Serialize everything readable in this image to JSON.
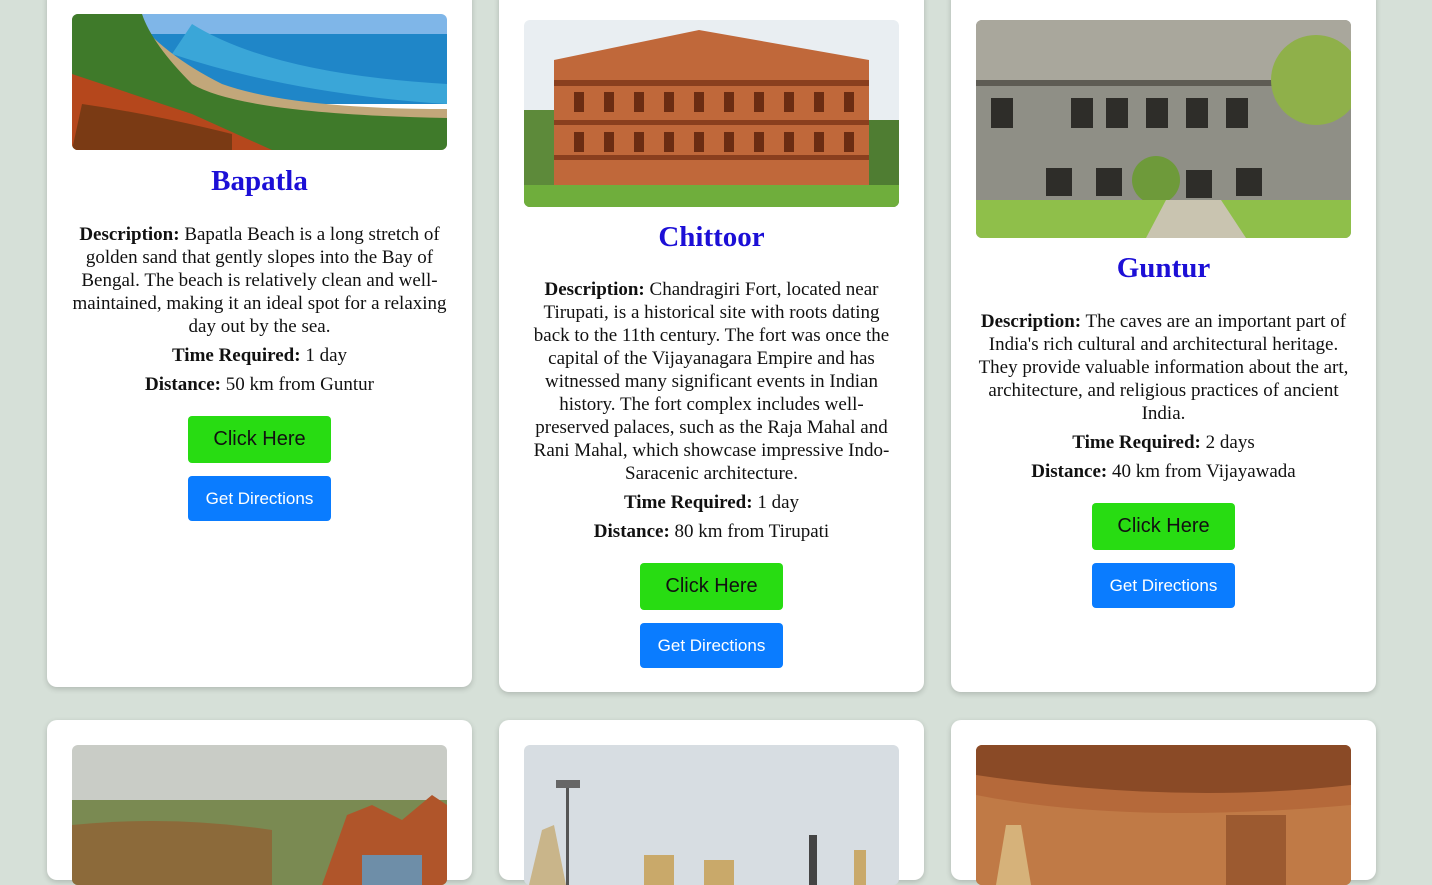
{
  "cards": [
    {
      "title": "Bapatla",
      "description_label": "Description:",
      "description": "Bapatla Beach is a long stretch of golden sand that gently slopes into the Bay of Bengal. The beach is relatively clean and well-maintained, making it an ideal spot for a relaxing day out by the sea.",
      "time_label": "Time Required:",
      "time": "1 day",
      "distance_label": "Distance:",
      "distance": "50 km from Guntur",
      "click_label": "Click Here",
      "directions_label": "Get Directions"
    },
    {
      "title": "Chittoor",
      "description_label": "Description:",
      "description": "Chandragiri Fort, located near Tirupati, is a historical site with roots dating back to the 11th century. The fort was once the capital of the Vijayanagara Empire and has witnessed many significant events in Indian history. The fort complex includes well-preserved palaces, such as the Raja Mahal and Rani Mahal, which showcase impressive Indo-Saracenic architecture.",
      "time_label": "Time Required:",
      "time": "1 day",
      "distance_label": "Distance:",
      "distance": "80 km from Tirupati",
      "click_label": "Click Here",
      "directions_label": "Get Directions"
    },
    {
      "title": "Guntur",
      "description_label": "Description:",
      "description": "The caves are an important part of India's rich cultural and architectural heritage. They provide valuable information about the art, architecture, and religious practices of ancient India.",
      "time_label": "Time Required:",
      "time": "2 days",
      "distance_label": "Distance:",
      "distance": "40 km from Vijayawada",
      "click_label": "Click Here",
      "directions_label": "Get Directions"
    }
  ],
  "colors": {
    "background": "#d6e0d8",
    "title": "#1c0fd6",
    "click_button": "#28dc12",
    "directions_button": "#0a7cff"
  }
}
